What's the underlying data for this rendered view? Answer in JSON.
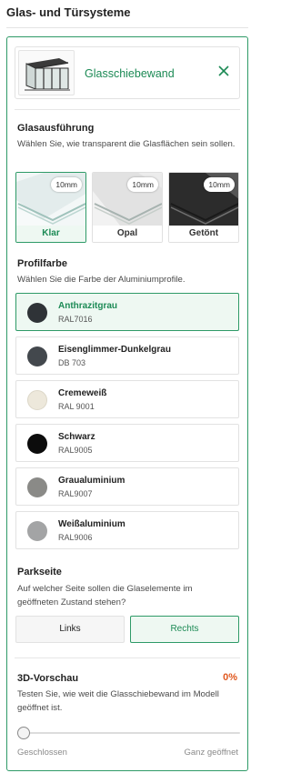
{
  "page": {
    "title": "Glas- und Türsysteme"
  },
  "product": {
    "name": "Glasschiebewand",
    "image_icon": "sliding-glass-wall-thumbnail",
    "close_icon": "close-icon"
  },
  "glass": {
    "title": "Glasausführung",
    "description": "Wählen Sie, wie transparent die Glasflächen sein sollen.",
    "options": [
      {
        "label": "Klar",
        "thickness": "10mm",
        "selected": true,
        "tint": "#e9f1f0"
      },
      {
        "label": "Opal",
        "thickness": "10mm",
        "selected": false,
        "tint": "#eeeeee"
      },
      {
        "label": "Getönt",
        "thickness": "10mm",
        "selected": false,
        "tint": "#3b3b3b"
      }
    ]
  },
  "profile": {
    "title": "Profilfarbe",
    "description": "Wählen Sie die Farbe der Aluminiumprofile.",
    "colors": [
      {
        "name": "Anthrazitgrau",
        "code": "RAL7016",
        "hex": "#2f3337",
        "selected": true
      },
      {
        "name": "Eisenglimmer-Dunkelgrau",
        "code": "DB 703",
        "hex": "#43484d",
        "selected": false
      },
      {
        "name": "Cremeweiß",
        "code": "RAL 9001",
        "hex": "#ede8db",
        "selected": false
      },
      {
        "name": "Schwarz",
        "code": "RAL9005",
        "hex": "#0c0c0c",
        "selected": false
      },
      {
        "name": "Graualuminium",
        "code": "RAL9007",
        "hex": "#8a8a87",
        "selected": false
      },
      {
        "name": "Weißaluminium",
        "code": "RAL9006",
        "hex": "#a3a4a5",
        "selected": false
      }
    ]
  },
  "park_side": {
    "title": "Parkseite",
    "description": "Auf welcher Seite sollen die Glaselemente im geöffneten Zustand stehen?",
    "options": [
      {
        "label": "Links",
        "active": false
      },
      {
        "label": "Rechts",
        "active": true
      }
    ]
  },
  "preview": {
    "title": "3D-Vorschau",
    "description": "Testen Sie, wie weit die Glasschiebewand im Modell geöffnet ist.",
    "percent_label": "0%",
    "value": 0,
    "min_label": "Geschlossen",
    "max_label": "Ganz geöffnet"
  },
  "colors": {
    "accent": "#2e9a67",
    "accent_text": "#1c8a55",
    "accent_bg": "#eef8f2",
    "warning": "#e0581f"
  }
}
